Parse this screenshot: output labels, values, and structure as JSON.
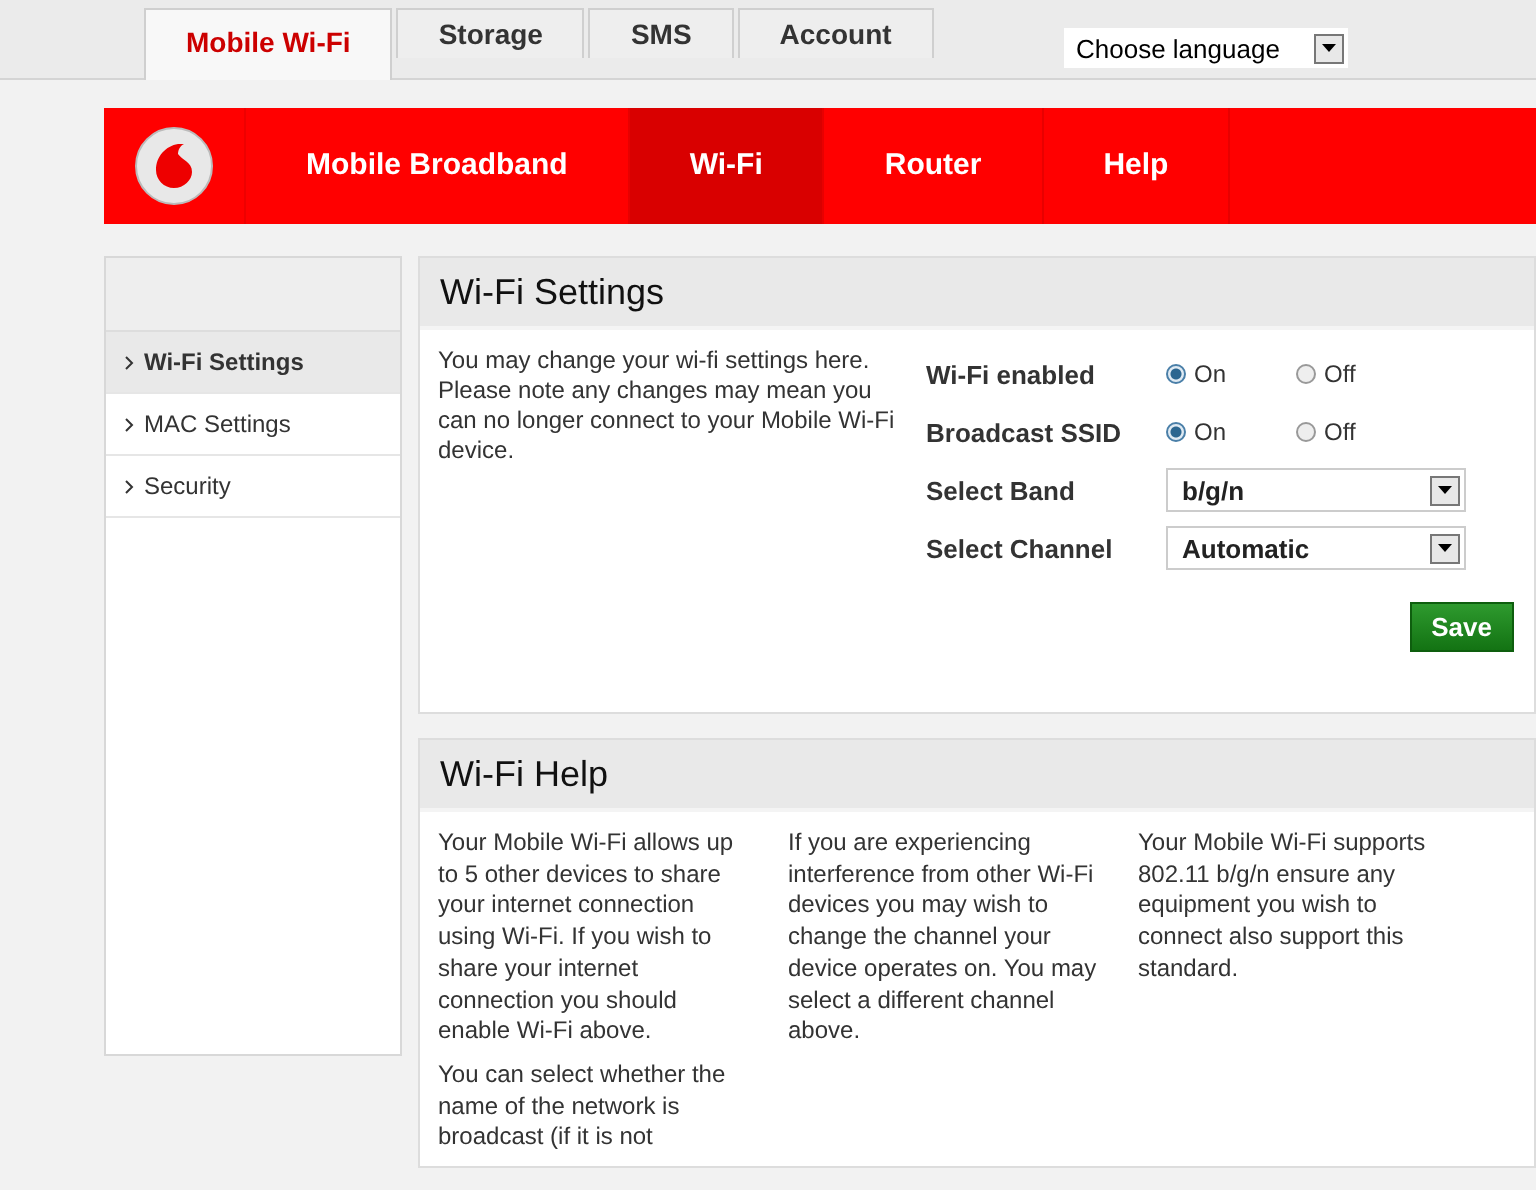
{
  "top_tabs": [
    {
      "label": "Mobile Wi-Fi",
      "selected": true
    },
    {
      "label": "Storage",
      "selected": false
    },
    {
      "label": "SMS",
      "selected": false
    },
    {
      "label": "Account",
      "selected": false
    }
  ],
  "language_select": {
    "value": "Choose language"
  },
  "main_nav": [
    {
      "label": "Mobile Broadband",
      "selected": false
    },
    {
      "label": "Wi-Fi",
      "selected": true
    },
    {
      "label": "Router",
      "selected": false
    },
    {
      "label": "Help",
      "selected": false
    }
  ],
  "sidebar": {
    "items": [
      {
        "label": "Wi-Fi Settings",
        "selected": true
      },
      {
        "label": "MAC Settings",
        "selected": false
      },
      {
        "label": "Security",
        "selected": false
      }
    ]
  },
  "settings": {
    "title": "Wi-Fi Settings",
    "intro": "You may change your wi-fi settings here. Please note any changes may mean you can no longer connect to your Mobile Wi-Fi device.",
    "rows": [
      {
        "kind": "radio",
        "label": "Wi-Fi enabled",
        "options": [
          {
            "label": "On",
            "selected": true
          },
          {
            "label": "Off",
            "selected": false
          }
        ]
      },
      {
        "kind": "radio",
        "label": "Broadcast SSID",
        "options": [
          {
            "label": "On",
            "selected": true
          },
          {
            "label": "Off",
            "selected": false
          }
        ]
      },
      {
        "kind": "select",
        "label": "Select Band",
        "value": "b/g/n"
      },
      {
        "kind": "select",
        "label": "Select Channel",
        "value": "Automatic"
      }
    ],
    "save_button": "Save"
  },
  "help": {
    "title": "Wi-Fi Help",
    "columns": [
      [
        "Your Mobile Wi-Fi allows up to 5 other devices to share your internet connection using Wi-Fi. If you wish to share your internet connection you should enable Wi-Fi above.",
        "You can select whether the name of the network is broadcast (if it is not"
      ],
      [
        "If you are experiencing interference from other Wi-Fi devices you may wish to change the channel your device operates on. You may select a different channel above."
      ],
      [
        "Your Mobile Wi-Fi supports 802.11 b/g/n ensure any equipment you wish to connect also support this standard."
      ]
    ]
  }
}
